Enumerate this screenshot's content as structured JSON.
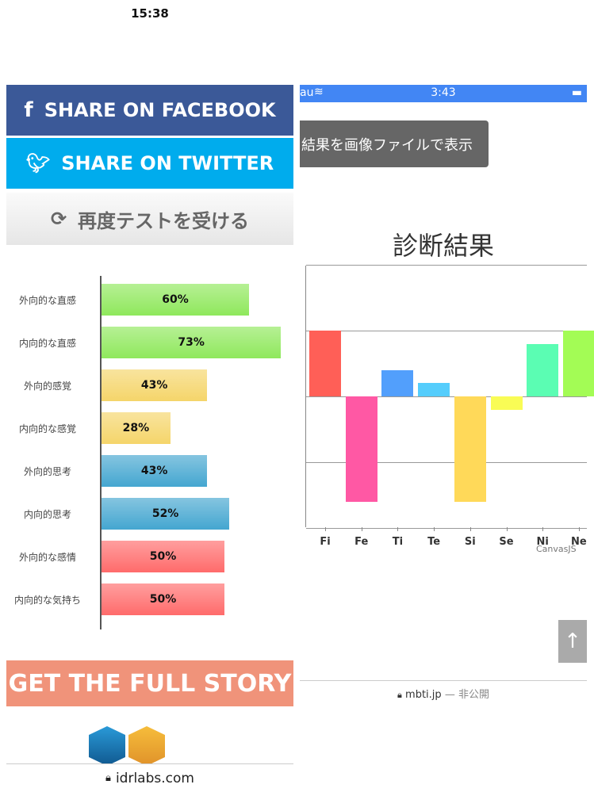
{
  "status_left": {
    "time": "15:38"
  },
  "share": {
    "facebook": "SHARE ON FACEBOOK",
    "twitter": "SHARE ON TWITTER",
    "retest": "再度テストを受ける"
  },
  "cta": "GET THE FULL STORY",
  "url_left": "idrlabs.com",
  "status_right": {
    "carrier": "au",
    "time": "3:43"
  },
  "image_button": "結果を画像ファイルで表示",
  "url_right": {
    "domain": "mbti.jp",
    "suffix": "— 非公開"
  },
  "scroll_top_icon": "arrow-up-icon",
  "chart_data": [
    {
      "type": "bar",
      "orientation": "horizontal",
      "categories": [
        "外向的な直感",
        "内向的な直感",
        "外向的感覚",
        "内向的な感覚",
        "外向的思考",
        "内向的思考",
        "外向的な感情",
        "内向的な気持ち"
      ],
      "values": [
        60,
        73,
        43,
        28,
        43,
        52,
        50,
        50
      ],
      "labels": [
        "60%",
        "73%",
        "43%",
        "28%",
        "43%",
        "52%",
        "50%",
        "50%"
      ],
      "colors": [
        "#8fe85c",
        "#8fe85c",
        "#f5d56a",
        "#f5d56a",
        "#44a6d0",
        "#44a6d0",
        "#ff6b6b",
        "#ff6b6b"
      ],
      "xlim": [
        0,
        100
      ]
    },
    {
      "type": "bar",
      "title": "診断結果",
      "categories": [
        "Fi",
        "Fe",
        "Ti",
        "Te",
        "Si",
        "Se",
        "Ni",
        "Ne"
      ],
      "values": [
        1.0,
        -1.6,
        0.4,
        0.2,
        -1.6,
        -0.2,
        0.8,
        1.0
      ],
      "colors": [
        "#ff5f57",
        "#ff58a4",
        "#529ffc",
        "#55cdfc",
        "#ffd959",
        "#f9fc55",
        "#5bfdb3",
        "#a3fc55"
      ],
      "ylim": [
        -2,
        2
      ],
      "grid": true,
      "credit": "CanvasJS"
    }
  ]
}
